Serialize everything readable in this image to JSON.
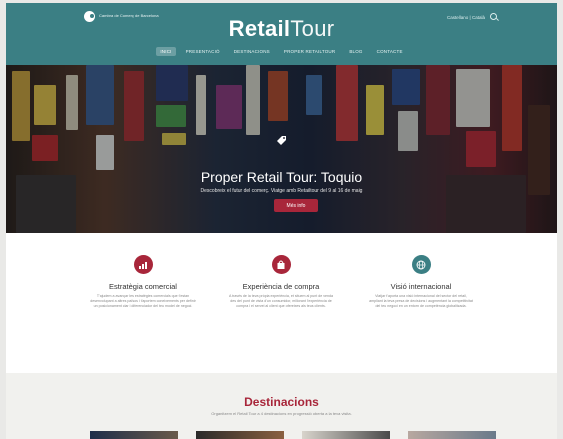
{
  "header": {
    "logo_text": "Cambra de Comerç de Barcelona",
    "brand_bold": "Retail",
    "brand_light": "Tour",
    "lang": "Castellano | Català"
  },
  "nav": {
    "items": [
      {
        "label": "INICI",
        "active": true
      },
      {
        "label": "PRESENTACIÓ"
      },
      {
        "label": "DESTINACIONS"
      },
      {
        "label": "PROPER RETAILTOUR"
      },
      {
        "label": "BLOG"
      },
      {
        "label": "CONTACTE"
      }
    ]
  },
  "hero": {
    "title": "Proper Retail Tour: Toquio",
    "subtitle": "Descobreix el futur del comerç. Viatge amb Retailtour del 9 al 16 de maig",
    "button": "Més info"
  },
  "features": [
    {
      "title": "Estratègia comercial",
      "desc": "T'ajudem a avançar les estratègies comercials que t'estan desenvolupant a altres països i t'aportem coneixements per definir un posicionament clar i diferenciador del teu model de negoci.",
      "color": "#a8263a",
      "icon": "chart-icon"
    },
    {
      "title": "Experiència de compra",
      "desc": "A través de la teva pròpia experiència, et situem al punt de venda des del punt de vista d'un consumidor, millorant l'experiència de compra i el servei al client que ofereixes als teus clients.",
      "color": "#a8263a",
      "icon": "shopping-bag-icon"
    },
    {
      "title": "Visió internacional",
      "desc": "Viatjar t'aporta una visió internacional del sector del retail, ampliant la teva presa de decisions i augmentant la competitivitat del teu negoci en un entorn de competència globalitzada.",
      "color": "#3b7f84",
      "icon": "globe-icon"
    }
  ],
  "destinations": {
    "title": "Destinacions",
    "subtitle": "Organitzem el Retail Tour a 4 destinacions en progressió oberta a la teva visita."
  },
  "colors": {
    "brand": "#3b7f84",
    "accent": "#a8263a"
  }
}
